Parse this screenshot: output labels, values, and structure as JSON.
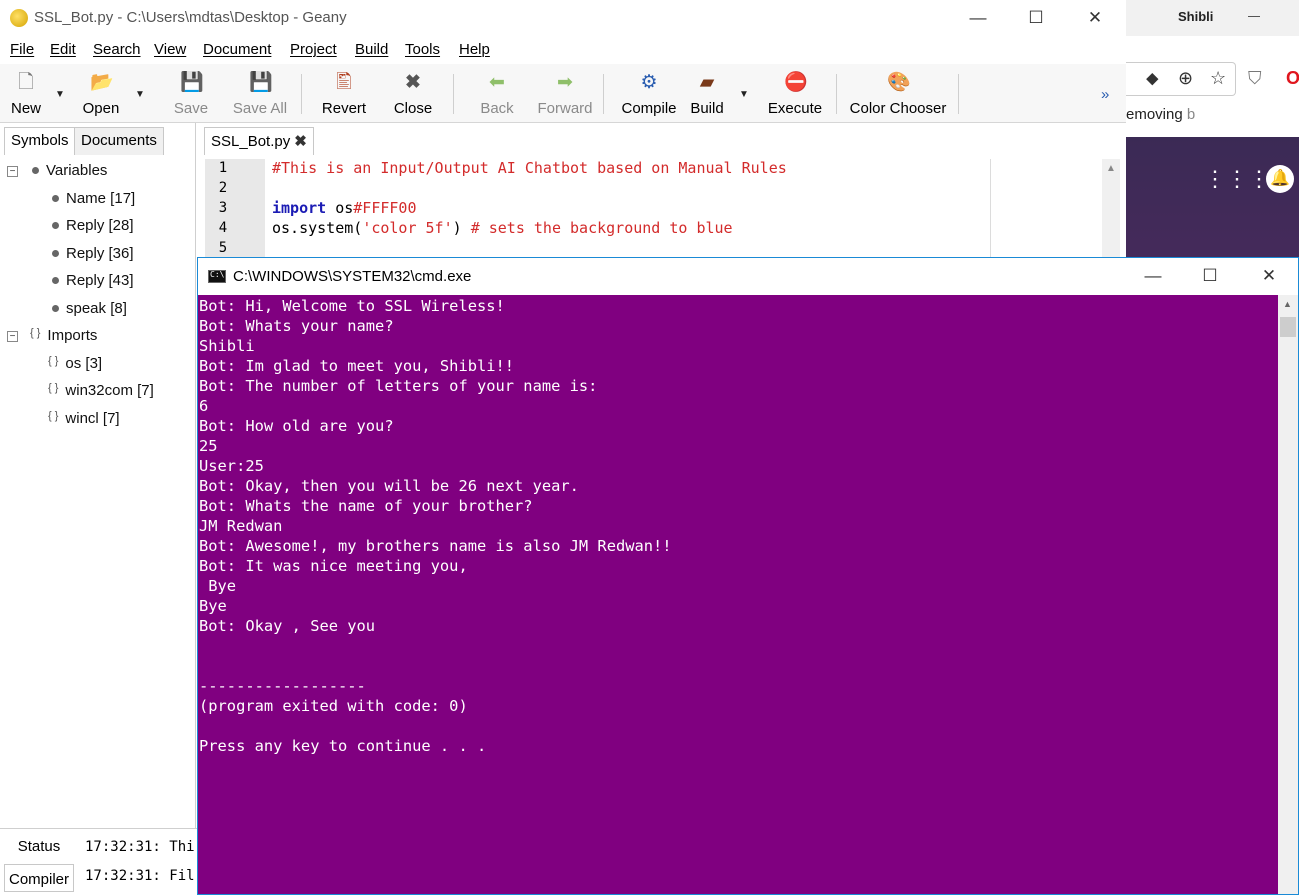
{
  "browser": {
    "profile_name": "Shibli",
    "minimize_label": "—",
    "restore_label": "▢",
    "bookmark_text": "emoving",
    "bookmark_faded": "b",
    "icons": [
      "extension-icon",
      "zoom-icon",
      "star-icon",
      "shield-icon",
      "opera-icon"
    ],
    "opera_glyph": "O"
  },
  "geany": {
    "title": "SSL_Bot.py - C:\\Users\\mdtas\\Desktop - Geany",
    "window_buttons": {
      "minimize": "—",
      "maximize": "☐",
      "close": "✕"
    },
    "menu": [
      "File",
      "Edit",
      "Search",
      "View",
      "Document",
      "Project",
      "Build",
      "Tools",
      "Help"
    ],
    "toolbar": {
      "new": "New",
      "open": "Open",
      "save": "Save",
      "save_all": "Save All",
      "revert": "Revert",
      "close": "Close",
      "back": "Back",
      "forward": "Forward",
      "compile": "Compile",
      "build": "Build",
      "execute": "Execute",
      "color_chooser": "Color Chooser",
      "overflow": "»"
    },
    "sidebar": {
      "tabs": [
        "Symbols",
        "Documents"
      ],
      "variables_label": "Variables",
      "variables": [
        "Name [17]",
        "Reply [28]",
        "Reply [36]",
        "Reply [43]",
        "speak [8]"
      ],
      "imports_label": "Imports",
      "imports": [
        "os [3]",
        "win32com [7]",
        "wincl [7]"
      ]
    },
    "editor": {
      "tab_label": "SSL_Bot.py",
      "tab_close": "✖",
      "line_numbers": [
        "1",
        "2",
        "3",
        "4",
        "5"
      ],
      "line1": "#This is an Input/Output AI Chatbot based on Manual Rules",
      "line3_kw": "import",
      "line3_mod": " os",
      "line3_tail": "#FFFF00",
      "line4_a": "os.system(",
      "line4_str": "'color 5f'",
      "line4_b": ") ",
      "line4_comment": "# sets the background to blue"
    },
    "bottom": {
      "tabs": [
        "Status",
        "Compiler"
      ],
      "status_line": "17:32:31: Thi",
      "compiler_line": "17:32:31: Fil"
    }
  },
  "cmd": {
    "title": "C:\\WINDOWS\\SYSTEM32\\cmd.exe",
    "window_buttons": {
      "minimize": "—",
      "maximize": "☐",
      "close": "✕"
    },
    "background_color": "#800080",
    "lines": [
      "Bot: Hi, Welcome to SSL Wireless!",
      "Bot: Whats your name?",
      "Shibli",
      "Bot: Im glad to meet you, Shibli!!",
      "Bot: The number of letters of your name is:",
      "6",
      "Bot: How old are you?",
      "25",
      "User:25",
      "Bot: Okay, then you will be 26 next year.",
      "Bot: Whats the name of your brother?",
      "JM Redwan",
      "Bot: Awesome!, my brothers name is also JM Redwan!!",
      "Bot: It was nice meeting you,",
      " Bye",
      "Bye",
      "Bot: Okay , See you",
      "",
      "",
      "------------------",
      "(program exited with code: 0)",
      "",
      "Press any key to continue . . ."
    ]
  }
}
